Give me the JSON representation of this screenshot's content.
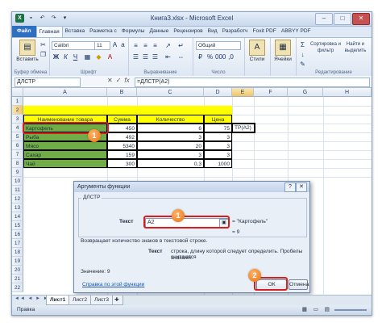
{
  "window": {
    "title": "Книга3.xlsx - Microsoft Excel",
    "app_icon": "excel-icon",
    "quick_access": [
      "save-icon",
      "undo-icon",
      "redo-icon",
      "customize-icon"
    ]
  },
  "ribbon_tabs": [
    "Файл",
    "Главная",
    "Вставка",
    "Разметка с",
    "Формулы",
    "Данные",
    "Рецензиров",
    "Вид",
    "Разработч",
    "Foxit PDF",
    "ABBYY PDF"
  ],
  "ribbon": {
    "paste_label": "Вставить",
    "clipboard_group": "Буфер обмена",
    "font_name": "Calibri",
    "font_size": "11",
    "bold": "Ж",
    "italic": "К",
    "underline": "Ч",
    "font_group": "Шрифт",
    "align_group": "Выравнивание",
    "number_format": "Общий",
    "number_group": "Число",
    "styles_label": "Стили",
    "cells_label": "Ячейки",
    "sort_label": "Сортировка и фильтр",
    "find_label": "Найти и выделить",
    "edit_group": "Редактирование"
  },
  "formula_bar": {
    "name_box": "ДЛСТР",
    "cancel": "✕",
    "enter": "✓",
    "fx": "fx",
    "formula": "=ДЛСТР(A2)"
  },
  "sheet": {
    "columns": [
      "A",
      "B",
      "C",
      "D",
      "E",
      "F",
      "G",
      "H"
    ],
    "rows": [
      "1",
      "2",
      "3",
      "4",
      "5",
      "6",
      "7",
      "8",
      "9",
      "10",
      "11",
      "12",
      "13",
      "14",
      "15",
      "16",
      "17",
      "18",
      "19",
      "20",
      "21",
      "22"
    ],
    "headers": [
      "Наименование товара",
      "Сумма",
      "Количество",
      "Цена"
    ],
    "data": [
      {
        "name": "Картофель",
        "sum": "450",
        "qty": "6",
        "price": "75"
      },
      {
        "name": "Рыба",
        "sum": "492",
        "qty": "3",
        "price": "3"
      },
      {
        "name": "Мясо",
        "sum": "5340",
        "qty": "20",
        "price": "3"
      },
      {
        "name": "Сахар",
        "sum": "159",
        "qty": "3",
        "price": "3"
      },
      {
        "name": "Чай",
        "sum": "300",
        "qty": "0,3",
        "price": "1000"
      }
    ],
    "edit_cell": "ТР(A2)"
  },
  "dialog": {
    "title": "Аргументы функции",
    "group_label": "ДЛСТР",
    "arg_label": "Текст",
    "arg_value": "A2",
    "arg_result": "= \"Картофель\"",
    "result_line": "= 9",
    "description": "Возвращает количество знаков в текстовой строке.",
    "param_name": "Текст",
    "param_desc_1": "строка, длину которой следует определить. Пробелы считаются",
    "param_desc_2": "знаками.",
    "value_label": "Значение:  9",
    "help_link": "Справка по этой функции",
    "ok": "ОК",
    "cancel": "Отмена",
    "help_btn": "?",
    "close_btn": "✕"
  },
  "callouts": {
    "one": "1",
    "two": "2"
  },
  "sheet_tabs": [
    "Лист1",
    "Лист2",
    "Лист3"
  ],
  "sheet_nav": "◄◄ ◄ ► ►►",
  "status": "Правка",
  "colors": {
    "yellow": "#ffff00",
    "green": "#70ad47",
    "callout_red": "#d62020",
    "badge_orange": "#e8720c"
  }
}
